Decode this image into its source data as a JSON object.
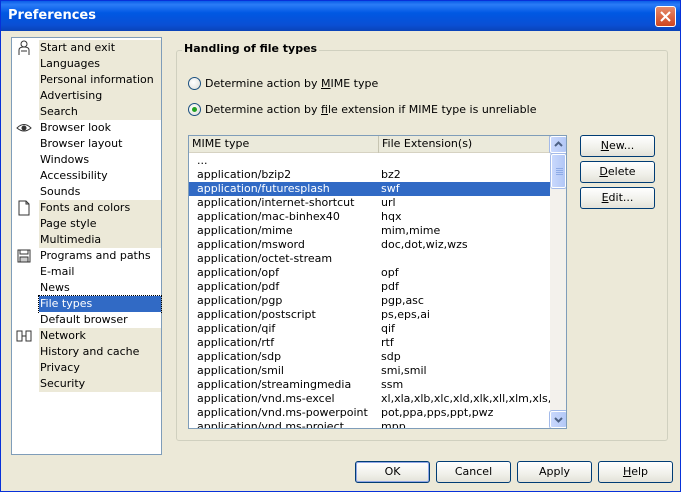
{
  "window": {
    "title": "Preferences"
  },
  "sidebar": {
    "items": [
      {
        "label": "Start and exit",
        "icon": "person-icon",
        "group": true
      },
      {
        "label": "Languages"
      },
      {
        "label": "Personal information"
      },
      {
        "label": "Advertising"
      },
      {
        "label": "Search"
      },
      {
        "label": "Browser look",
        "icon": "eye-icon",
        "group": true
      },
      {
        "label": "Browser layout"
      },
      {
        "label": "Windows"
      },
      {
        "label": "Accessibility"
      },
      {
        "label": "Sounds"
      },
      {
        "label": "Fonts and colors",
        "icon": "document-icon",
        "group": true
      },
      {
        "label": "Page style"
      },
      {
        "label": "Multimedia"
      },
      {
        "label": "Programs and paths",
        "icon": "floppy-disk-icon",
        "group": true
      },
      {
        "label": "E-mail"
      },
      {
        "label": "News"
      },
      {
        "label": "File types",
        "selected": true
      },
      {
        "label": "Default browser"
      },
      {
        "label": "Network",
        "icon": "network-icon",
        "group": true
      },
      {
        "label": "History and cache"
      },
      {
        "label": "Privacy"
      },
      {
        "label": "Security"
      }
    ]
  },
  "filetypes": {
    "group_title": "Handling of file types",
    "radio_mime": {
      "pre": "Determine action by ",
      "accel": "M",
      "post": "IME type",
      "checked": false
    },
    "radio_ext": {
      "pre": "Determine action by ",
      "accel": "f",
      "post": "ile extension if MIME type is unreliable",
      "checked": true
    },
    "columns": [
      "MIME type",
      "File Extension(s)"
    ],
    "rows": [
      [
        "...",
        ""
      ],
      [
        "application/bzip2",
        "bz2"
      ],
      [
        "application/futuresplash",
        "swf"
      ],
      [
        "application/internet-shortcut",
        "url"
      ],
      [
        "application/mac-binhex40",
        "hqx"
      ],
      [
        "application/mime",
        "mim,mime"
      ],
      [
        "application/msword",
        "doc,dot,wiz,wzs"
      ],
      [
        "application/octet-stream",
        ""
      ],
      [
        "application/opf",
        "opf"
      ],
      [
        "application/pdf",
        "pdf"
      ],
      [
        "application/pgp",
        "pgp,asc"
      ],
      [
        "application/postscript",
        "ps,eps,ai"
      ],
      [
        "application/qif",
        "qif"
      ],
      [
        "application/rtf",
        "rtf"
      ],
      [
        "application/sdp",
        "sdp"
      ],
      [
        "application/smil",
        "smi,smil"
      ],
      [
        "application/streamingmedia",
        "ssm"
      ],
      [
        "application/vnd.ms-excel",
        "xl,xla,xlb,xlc,xld,xlk,xll,xlm,xls,xlt,xlv,xlw"
      ],
      [
        "application/vnd.ms-powerpoint",
        "pot,ppa,pps,ppt,pwz"
      ],
      [
        "application/vnd.ms-project",
        "mpp"
      ]
    ],
    "selected_row": 2,
    "buttons": {
      "new": {
        "accel": "N",
        "rest": "ew..."
      },
      "delete": {
        "accel": "D",
        "rest": "elete"
      },
      "edit": {
        "accel": "E",
        "rest": "dit..."
      }
    }
  },
  "footer": {
    "ok": "OK",
    "cancel": "Cancel",
    "apply": "Apply",
    "help": {
      "accel": "H",
      "rest": "elp"
    }
  }
}
